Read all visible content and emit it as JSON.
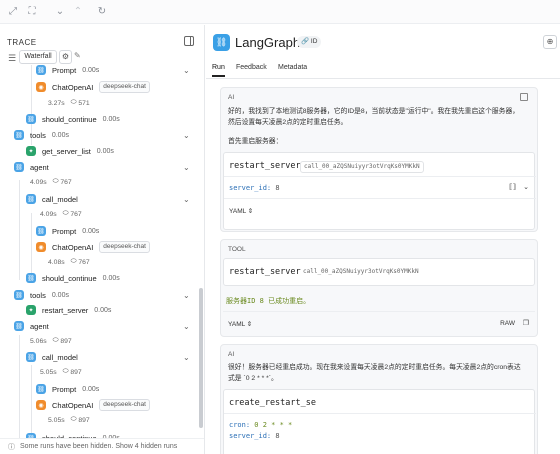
{
  "toolbar": {
    "icons": [
      "expand-icon",
      "collapse-icon",
      "chevron-down-icon",
      "chevron-up-icon",
      "refresh-icon"
    ]
  },
  "trace": {
    "title": "TRACE",
    "waterfall_label": "Waterfall",
    "hidden_runs_note": "Some runs have been hidden. Show 4 hidden runs",
    "rows": [
      {
        "label": "Prompt",
        "duration": "0.00s",
        "icon": "chain"
      },
      {
        "label": "ChatOpenAI",
        "tag": "deepseek-chat",
        "icon": "llm",
        "meta_duration": "3.27s",
        "tokens": "571"
      },
      {
        "label": "should_continue",
        "duration": "0.00s",
        "icon": "chain"
      },
      {
        "label": "tools",
        "duration": "0.00s",
        "icon": "chain"
      },
      {
        "label": "get_server_list",
        "duration": "0.00s",
        "icon": "tool"
      },
      {
        "label": "agent",
        "icon": "chain",
        "meta_duration": "4.09s",
        "tokens": "767"
      },
      {
        "label": "call_model",
        "icon": "chain",
        "meta_duration": "4.09s",
        "tokens": "767"
      },
      {
        "label": "Prompt",
        "duration": "0.00s",
        "icon": "chain"
      },
      {
        "label": "ChatOpenAI",
        "tag": "deepseek-chat",
        "icon": "llm",
        "meta_duration": "4.08s",
        "tokens": "767"
      },
      {
        "label": "should_continue",
        "duration": "0.00s",
        "icon": "chain"
      },
      {
        "label": "tools",
        "duration": "0.00s",
        "icon": "chain"
      },
      {
        "label": "restart_server",
        "duration": "0.00s",
        "icon": "tool"
      },
      {
        "label": "agent",
        "icon": "chain",
        "meta_duration": "5.06s",
        "tokens": "897"
      },
      {
        "label": "call_model",
        "icon": "chain",
        "meta_duration": "5.05s",
        "tokens": "897"
      },
      {
        "label": "Prompt",
        "duration": "0.00s",
        "icon": "chain"
      },
      {
        "label": "ChatOpenAI",
        "tag": "deepseek-chat",
        "icon": "llm",
        "meta_duration": "5.05s",
        "tokens": "897"
      },
      {
        "label": "should_continue",
        "duration": "0.00s",
        "icon": "chain"
      }
    ]
  },
  "run": {
    "title": "LangGraph",
    "id_badge": "ID",
    "tabs": [
      "Run",
      "Feedback",
      "Metadata"
    ],
    "messages": [
      {
        "role": "AI",
        "text_line1": "好的，我找到了本地测试8服务器，它的ID是8，当前状态是\"运行中\"。我在我先重启这个服务器，",
        "text_line2": "然后设置每天凌晨2点的定时重启任务。",
        "text_line3": "首先重启服务器：",
        "tool_call": {
          "name": "restart_server",
          "id": "call_00_aZQSNuiyyr3otVrqKs0YMKkN",
          "arg_key": "server_id:",
          "arg_value": "8",
          "format": "YAML"
        }
      },
      {
        "role": "TOOL",
        "tool_call": {
          "name": "restart_server",
          "id": "call_00_aZQSNuiyyr3otVrqKs0YMKkN"
        },
        "result": "服务器ID 8 已成功重启。",
        "format": "YAML",
        "raw_label": "RAW"
      },
      {
        "role": "AI",
        "text_line1": "很好！服务器已经重启成功。现在我来设置每天凌晨2点的定时重启任务。每天凌晨2点的cron表达",
        "text_line2": "式是 `0 2 * * *`。",
        "tool_call": {
          "name": "create_restart_se",
          "cron_key": "cron:",
          "cron_value": "0 2 * * *",
          "arg_key": "server_id:",
          "arg_value": "8"
        }
      }
    ]
  },
  "colors": {
    "chain": "#4aa3e6",
    "llm": "#f08c2c",
    "tool": "#2aa36b",
    "code_key": "#2b6fb6",
    "result_green": "#6a8a1f"
  }
}
